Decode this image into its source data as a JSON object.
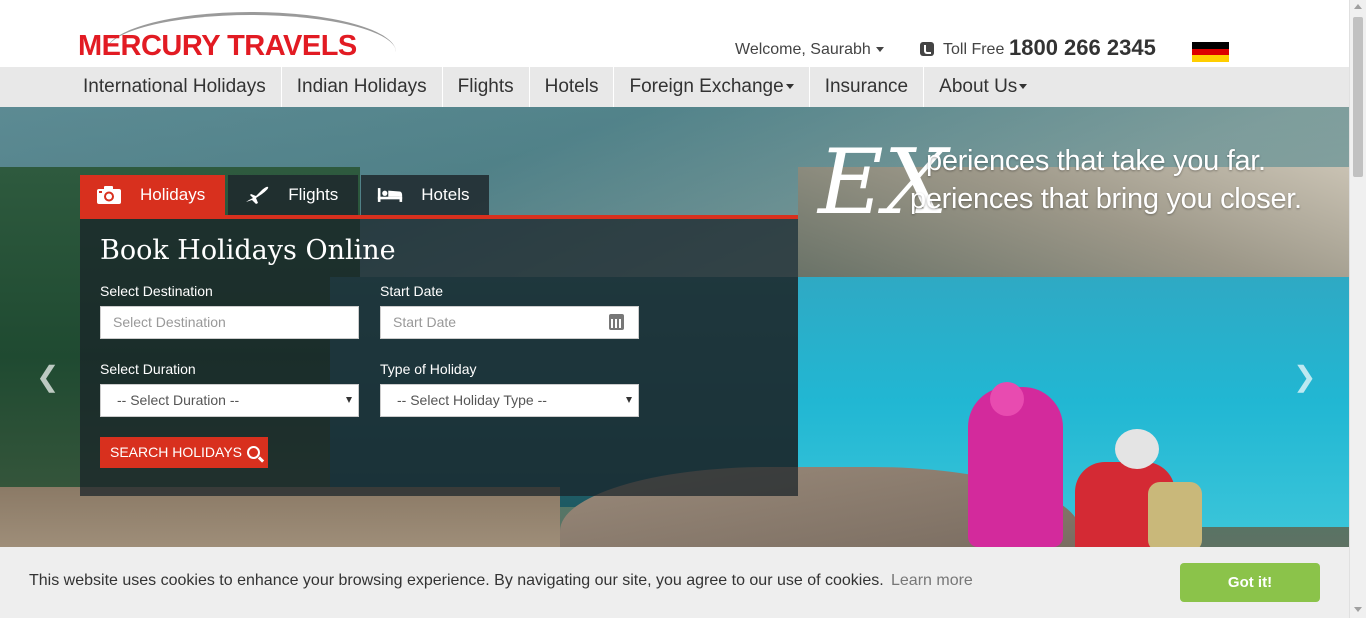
{
  "header": {
    "logo_text": "MERCURY TRAVELS",
    "welcome": "Welcome, Saurabh",
    "toll_free_label": "Toll Free",
    "toll_free_number": "1800 266 2345",
    "flag_colors": [
      "#000000",
      "#dd0000",
      "#ffce00"
    ]
  },
  "nav": {
    "items": [
      {
        "label": "International Holidays"
      },
      {
        "label": "Indian Holidays"
      },
      {
        "label": "Flights"
      },
      {
        "label": "Hotels"
      },
      {
        "label": "Foreign Exchange",
        "dropdown": true
      },
      {
        "label": "Insurance"
      },
      {
        "label": "About Us",
        "dropdown": true
      }
    ]
  },
  "hero": {
    "slogan_big_letter": "EX",
    "slogan_line1": "periences that take you far.",
    "slogan_line2": "periences that bring you closer.",
    "prev_icon": "chevron-left-icon",
    "next_icon": "chevron-right-icon"
  },
  "booking": {
    "tabs": [
      {
        "label": "Holidays",
        "icon": "camera-icon",
        "active": true
      },
      {
        "label": "Flights",
        "icon": "plane-icon",
        "active": false
      },
      {
        "label": "Hotels",
        "icon": "bed-icon",
        "active": false
      }
    ],
    "title": "Book Holidays Online",
    "destination_label": "Select Destination",
    "destination_placeholder": "Select Destination",
    "start_date_label": "Start Date",
    "start_date_placeholder": "Start Date",
    "duration_label": "Select Duration",
    "duration_value": "-- Select Duration --",
    "holiday_type_label": "Type of Holiday",
    "holiday_type_value": "-- Select Holiday Type --",
    "search_button": "SEARCH HOLIDAYS",
    "accent_color": "#d8301e"
  },
  "cookie": {
    "message": "This website uses cookies to enhance your browsing experience. By navigating our site, you agree to our use of cookies.",
    "learn_more": "Learn more",
    "accept": "Got it!"
  }
}
